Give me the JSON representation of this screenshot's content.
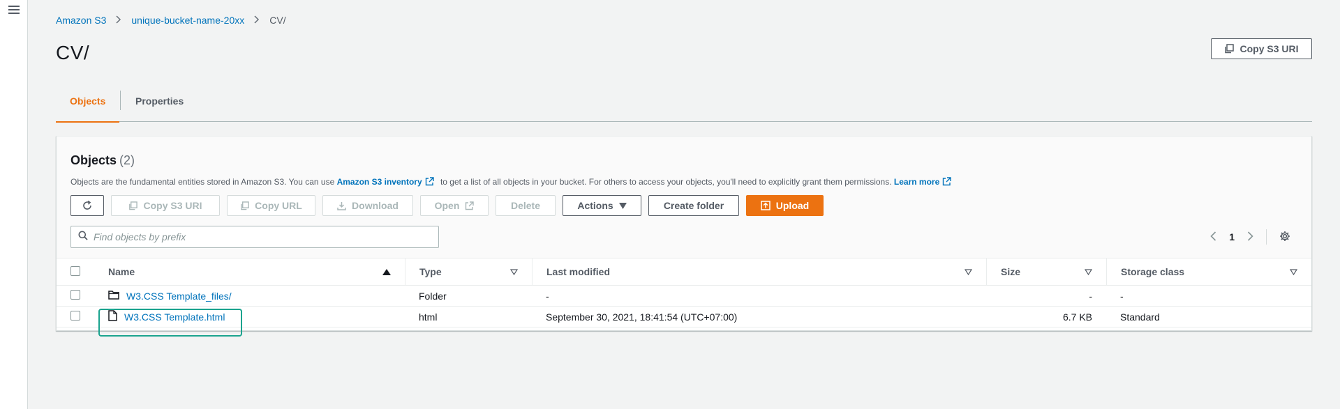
{
  "breadcrumb": {
    "items": [
      "Amazon S3",
      "unique-bucket-name-20xx",
      "CV/"
    ]
  },
  "page": {
    "title": "CV/",
    "copy_uri_label": "Copy S3 URI"
  },
  "tabs": [
    {
      "label": "Objects",
      "active": true
    },
    {
      "label": "Properties",
      "active": false
    }
  ],
  "objects_panel": {
    "title": "Objects",
    "count": "(2)",
    "description_pre": "Objects are the fundamental entities stored in Amazon S3. You can use",
    "description_link": "Amazon S3 inventory",
    "description_mid": "to get a list of all objects in your bucket. For others to access your objects, you'll need to explicitly grant them permissions.",
    "learn_more": "Learn more"
  },
  "toolbar": {
    "copy_s3_uri": "Copy S3 URI",
    "copy_url": "Copy URL",
    "download": "Download",
    "open": "Open",
    "delete": "Delete",
    "actions": "Actions",
    "create_folder": "Create folder",
    "upload": "Upload"
  },
  "search": {
    "placeholder": "Find objects by prefix"
  },
  "pagination": {
    "current_page": "1"
  },
  "table": {
    "columns": [
      "Name",
      "Type",
      "Last modified",
      "Size",
      "Storage class"
    ],
    "rows": [
      {
        "name": "W3.CSS Template_files/",
        "kind": "folder",
        "type": "Folder",
        "last_modified": "-",
        "size": "-",
        "storage_class": "-"
      },
      {
        "name": "W3.CSS Template.html",
        "kind": "file",
        "type": "html",
        "last_modified": "September 30, 2021, 18:41:54 (UTC+07:00)",
        "size": "6.7 KB",
        "storage_class": "Standard"
      }
    ]
  },
  "colors": {
    "accent": "#ec7211",
    "link": "#0073bb",
    "highlight": "#1aa38e"
  }
}
